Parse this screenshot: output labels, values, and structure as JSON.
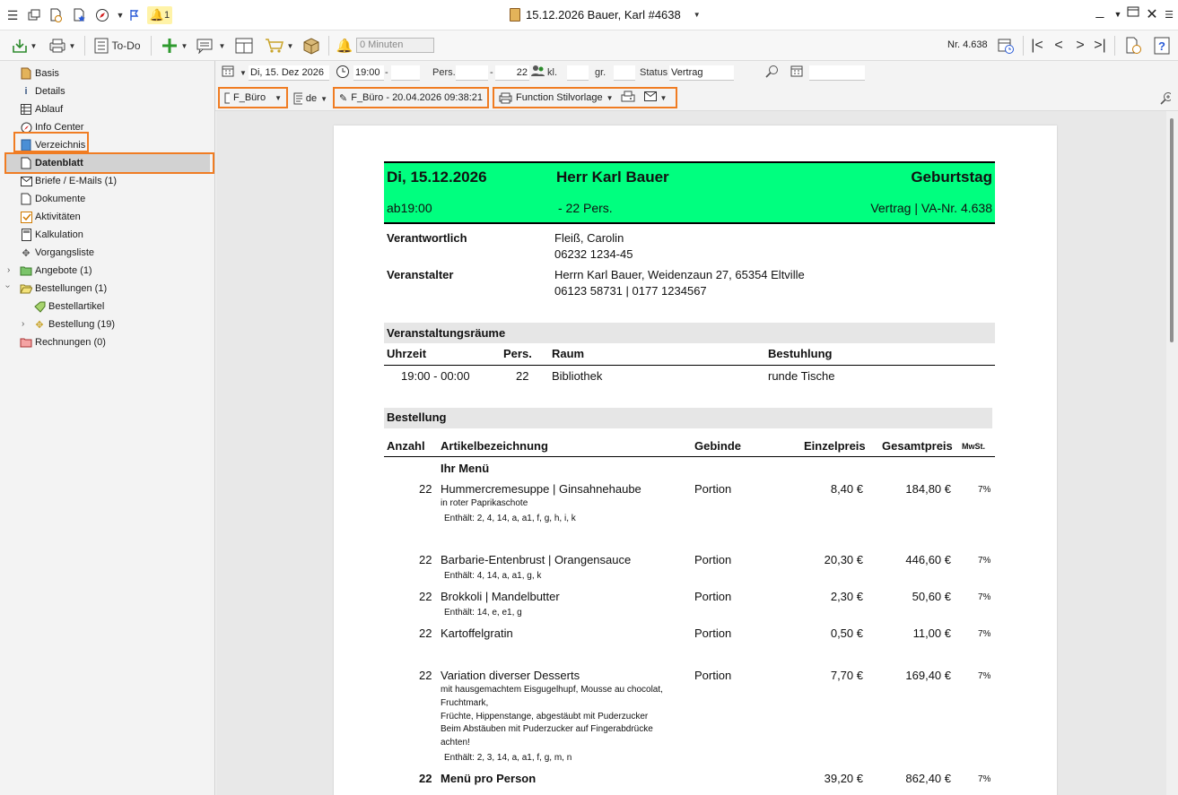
{
  "window": {
    "title": "15.12.2026 Bauer, Karl #4638",
    "notification_count": "1"
  },
  "toolbar": {
    "todo_label": "To-Do",
    "minuten_placeholder": "0 Minuten",
    "nr_label": "Nr. 4.638"
  },
  "sidebar": {
    "items": [
      {
        "label": "Basis",
        "icon": "doc-icon"
      },
      {
        "label": "Details",
        "icon": "info-icon"
      },
      {
        "label": "Ablauf",
        "icon": "table-icon"
      },
      {
        "label": "Info Center",
        "icon": "compass-icon"
      },
      {
        "label": "Verzeichnis",
        "icon": "book-icon"
      },
      {
        "label": "Datenblatt",
        "icon": "doc-icon"
      },
      {
        "label": "Briefe / E-Mails (1)",
        "icon": "mail-icon"
      },
      {
        "label": "Dokumente",
        "icon": "doc-icon"
      },
      {
        "label": "Aktivitäten",
        "icon": "check-icon"
      },
      {
        "label": "Kalkulation",
        "icon": "calc-icon"
      },
      {
        "label": "Vorgangsliste",
        "icon": "puzzle-icon"
      },
      {
        "label": "Angebote (1)",
        "icon": "folder-icon"
      },
      {
        "label": "Bestellungen (1)",
        "icon": "folder-open-icon"
      },
      {
        "label": "Bestellartikel",
        "icon": "tag-icon"
      },
      {
        "label": "Bestellung (19)",
        "icon": "puzzle-icon"
      },
      {
        "label": "Rechnungen (0)",
        "icon": "folder-red-icon"
      }
    ]
  },
  "filter": {
    "date": "Di, 15. Dez 2026",
    "time": "19:00",
    "dash1": "-",
    "pers_label": "Pers.",
    "dash2": "-",
    "pers_value": "22",
    "kl_label": "kl.",
    "gr_label": "gr.",
    "status_label": "Status",
    "status_value": "Vertrag"
  },
  "doctool": {
    "template": "F_Büro",
    "language": "de",
    "edit_label": "F_Büro - 20.04.2026 09:38:21",
    "print_label": "Function Stilvorlage"
  },
  "document": {
    "banner": {
      "date": "Di, 15.12.2026",
      "name": "Herr Karl Bauer",
      "type": "Geburtstag",
      "time": "ab19:00",
      "pers": "- 22 Pers.",
      "contract": "Vertrag | VA-Nr. 4.638"
    },
    "verantwortlich_label": "Verantwortlich",
    "verantwortlich_name": "Fleiß, Carolin",
    "verantwortlich_phone": "06232 1234-45",
    "veranstalter_label": "Veranstalter",
    "veranstalter_address": "Herrn Karl Bauer, Weidenzaun 27, 65354 Eltville",
    "veranstalter_phone": "06123 58731 | 0177 1234567",
    "rooms_title": "Veranstaltungsräume",
    "rooms_headers": [
      "Uhrzeit",
      "Pers.",
      "Raum",
      "Bestuhlung"
    ],
    "rooms_row": [
      "19:00 - 00:00",
      "22",
      "Bibliothek",
      "runde Tische"
    ],
    "order_title": "Bestellung",
    "order_headers": [
      "Anzahl",
      "Artikelbezeichnung",
      "Gebinde",
      "Einzelpreis",
      "Gesamtpreis",
      "MwSt."
    ],
    "menu_title": "Ihr Menü",
    "items": [
      {
        "qty": "22",
        "name": "Hummercremesuppe | Ginsahnehaube",
        "desc": "in roter Paprikaschote",
        "contains": "Enthält: 2, 4, 14, a, a1, f, g, h, i, k",
        "unit": "Portion",
        "price": "8,40 €",
        "total": "184,80 €",
        "vat": "7%"
      },
      {
        "qty": "22",
        "name": "Barbarie-Entenbrust | Orangensauce",
        "contains": "Enthält: 4, 14, a, a1, g, k",
        "unit": "Portion",
        "price": "20,30 €",
        "total": "446,60 €",
        "vat": "7%"
      },
      {
        "qty": "22",
        "name": "Brokkoli | Mandelbutter",
        "contains": "Enthält: 14, e, e1, g",
        "unit": "Portion",
        "price": "2,30 €",
        "total": "50,60 €",
        "vat": "7%"
      },
      {
        "qty": "22",
        "name": "Kartoffelgratin",
        "unit": "Portion",
        "price": "0,50 €",
        "total": "11,00 €",
        "vat": "7%"
      },
      {
        "qty": "22",
        "name": "Variation diverser Desserts",
        "desc_lines": [
          "mit hausgemachtem Eisgugelhupf, Mousse au chocolat,",
          "Fruchtmark,",
          "Früchte, Hippenstange, abgestäubt mit Puderzucker",
          "Beim Abstäuben mit Puderzucker auf Fingerabdrücke",
          "achten!"
        ],
        "contains": "Enthält: 2, 3, 14, a, a1, f, g, m, n",
        "unit": "Portion",
        "price": "7,70 €",
        "total": "169,40 €",
        "vat": "7%"
      },
      {
        "qty": "22",
        "name": "Menü pro Person",
        "price": "39,20 €",
        "total": "862,40 €",
        "vat": "7%"
      }
    ]
  },
  "colors": {
    "accent_orange": "#f07c22",
    "banner_green": "#00ff7f"
  }
}
